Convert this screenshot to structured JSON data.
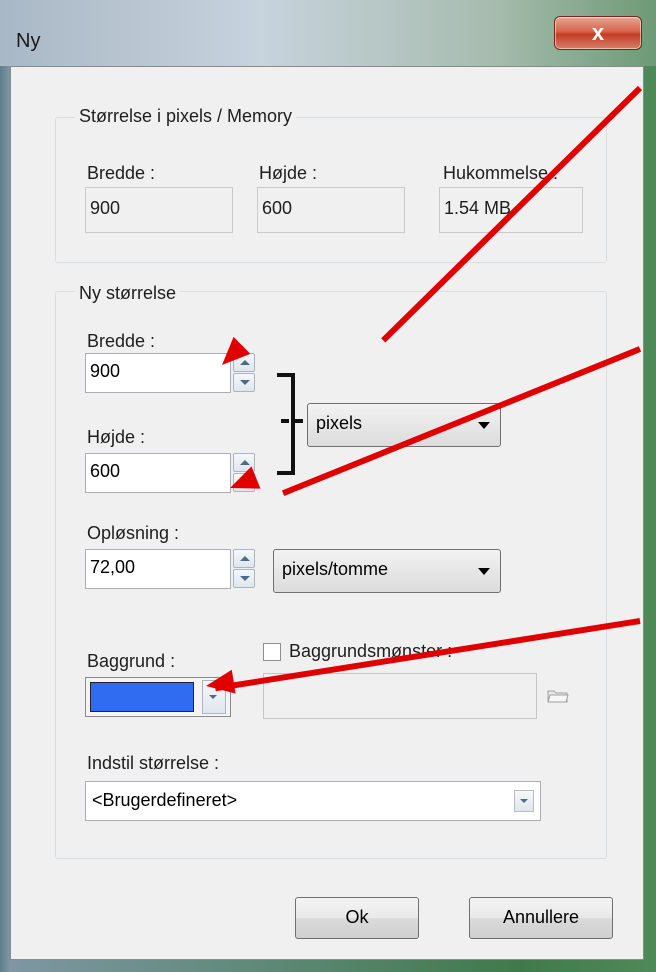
{
  "window": {
    "title": "Ny",
    "close_glyph": "x"
  },
  "memory_group": {
    "legend": "Størrelse i pixels / Memory",
    "width_label": "Bredde :",
    "width_value": "900",
    "height_label": "Højde :",
    "height_value": "600",
    "memory_label": "Hukommelse :",
    "memory_value": "1.54 MB"
  },
  "new_size_group": {
    "legend": "Ny størrelse",
    "width_label": "Bredde :",
    "width_value": "900",
    "height_label": "Højde :",
    "height_value": "600",
    "unit_select": "pixels",
    "resolution_label": "Opløsning :",
    "resolution_value": "72,00",
    "resolution_unit_select": "pixels/tomme",
    "background_label": "Baggrund :",
    "background_color": "#2f6cf2",
    "pattern_label": "Baggrundsmønster :",
    "pattern_checked": false,
    "preset_label": "Indstil størrelse :",
    "preset_select": "<Brugerdefineret>"
  },
  "buttons": {
    "ok": "Ok",
    "cancel": "Annullere"
  },
  "annotation_color": "#e00000"
}
